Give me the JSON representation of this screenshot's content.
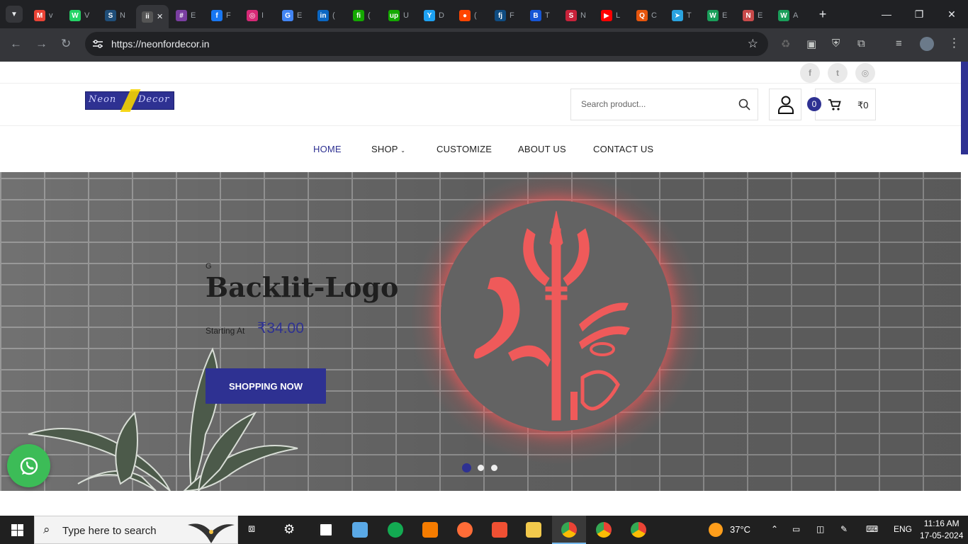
{
  "tabs": [
    {
      "letter": "M",
      "title": "v",
      "color": "#ea4335"
    },
    {
      "letter": "W",
      "title": "V",
      "color": "#25d366"
    },
    {
      "letter": "S",
      "title": "N",
      "color": "#1f4e79"
    },
    {
      "letter": "ii",
      "title": "",
      "color": "#444"
    },
    {
      "letter": "#",
      "title": "E",
      "color": "#7a3ea1"
    },
    {
      "letter": "f",
      "title": "F",
      "color": "#1877f2"
    },
    {
      "letter": "◎",
      "title": "I",
      "color": "#d62976"
    },
    {
      "letter": "G",
      "title": "E",
      "color": "#4285f4"
    },
    {
      "letter": "in",
      "title": "(",
      "color": "#0a66c2"
    },
    {
      "letter": "fi",
      "title": "(",
      "color": "#14a800"
    },
    {
      "letter": "up",
      "title": "U",
      "color": "#14a800"
    },
    {
      "letter": "Y",
      "title": "D",
      "color": "#1da1f2"
    },
    {
      "letter": "●",
      "title": "(",
      "color": "#ff4500"
    },
    {
      "letter": "fj",
      "title": "F",
      "color": "#0f4c81"
    },
    {
      "letter": "B",
      "title": "T",
      "color": "#1656d6"
    },
    {
      "letter": "S",
      "title": "N",
      "color": "#c7223a"
    },
    {
      "letter": "▶",
      "title": "L",
      "color": "#ff0000"
    },
    {
      "letter": "Q",
      "title": "C",
      "color": "#e6550d"
    },
    {
      "letter": "➤",
      "title": "T",
      "color": "#2aa3e0"
    },
    {
      "letter": "W",
      "title": "E",
      "color": "#1a9e5a"
    },
    {
      "letter": "N",
      "title": "E",
      "color": "#c84a4a"
    },
    {
      "letter": "W",
      "title": "A",
      "color": "#1a9e5a"
    }
  ],
  "active_tab": {
    "letter": "ii",
    "close": "✕"
  },
  "new_tab": "+",
  "window": {
    "min": "—",
    "max": "❐",
    "close": "✕"
  },
  "address": {
    "url": "https://neonfordecor.in"
  },
  "site": {
    "logo_left": "Neon",
    "logo_right": "Decor",
    "search_placeholder": "Search product...",
    "cart_count": "0",
    "cart_total": "₹0",
    "social": [
      "f",
      "t",
      "◎"
    ],
    "menu": {
      "home": "HOME",
      "shop": "SHOP",
      "customize": "CUSTOMIZE",
      "about": "ABOUT US",
      "contact": "CONTACT US"
    }
  },
  "hero": {
    "eyebrow": "G",
    "title": "Backlit-Logo",
    "starting": "Starting At",
    "price": "₹34.00",
    "cta": "SHOPPING NOW",
    "slides": 3,
    "active_slide": 1
  },
  "taskbar": {
    "search": "Type here to search",
    "weather": "37°C",
    "lang": "ENG",
    "time": "11:16 AM",
    "date": "17-05-2024"
  },
  "colors": {
    "brand": "#2e3192",
    "glow": "#ff5a5a",
    "whatsapp": "#3cbc57"
  }
}
